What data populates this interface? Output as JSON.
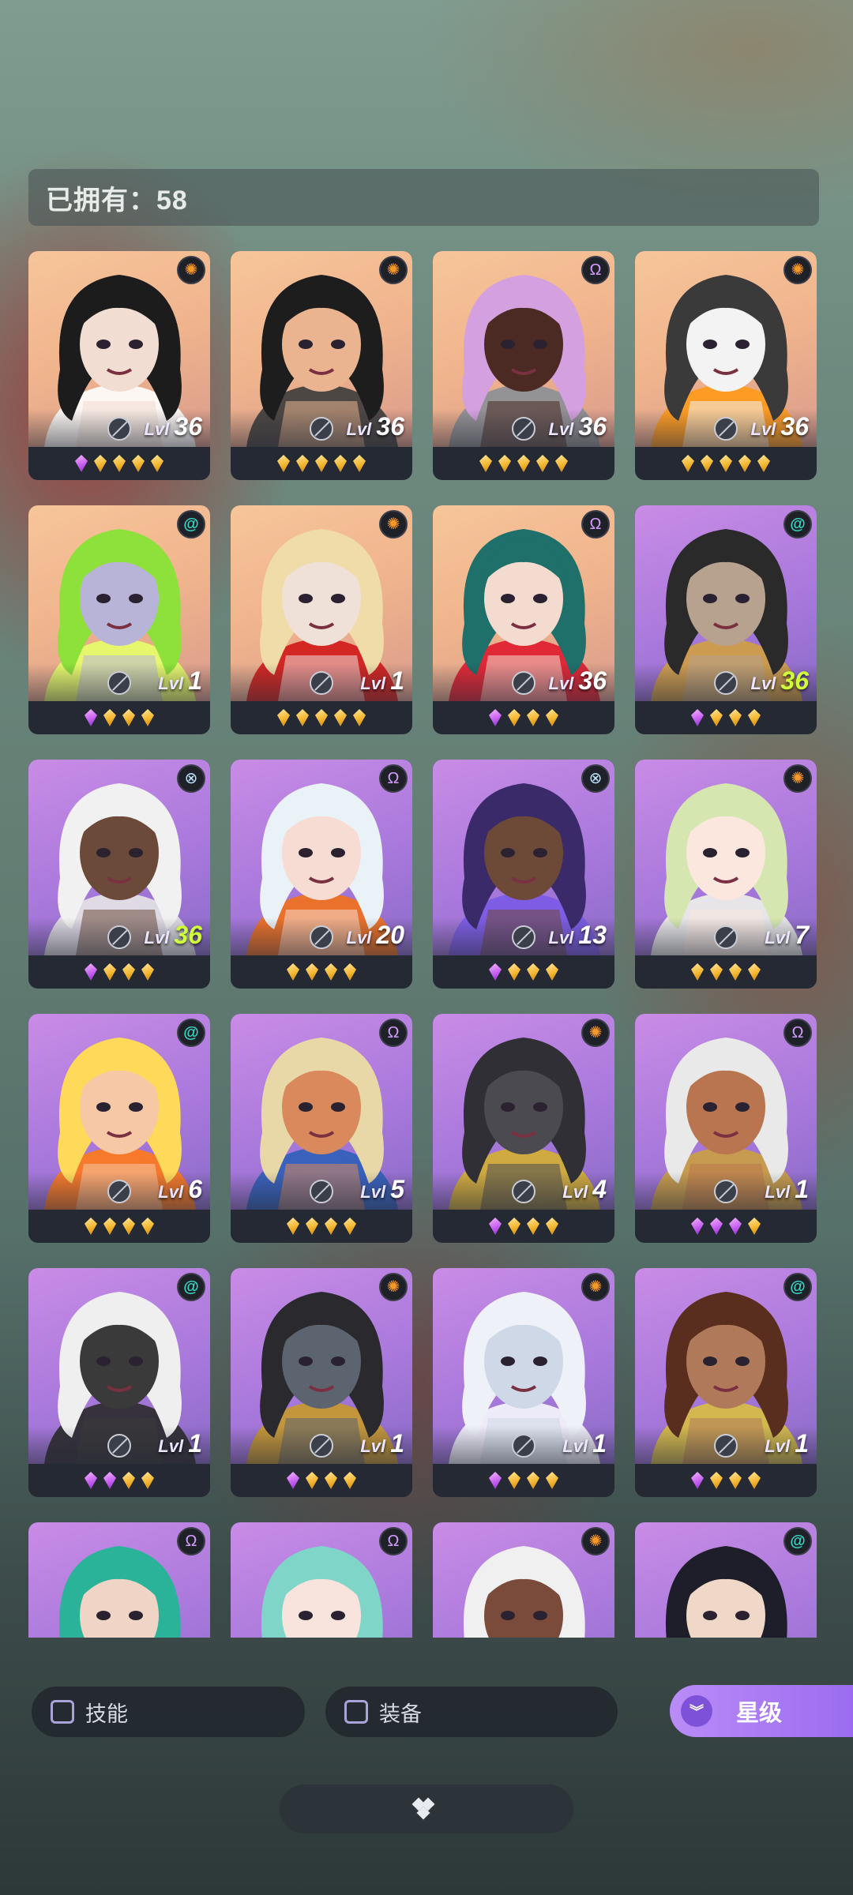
{
  "owned": {
    "label": "已拥有：58"
  },
  "heroes": [
    {
      "element": "sun",
      "bg": "peach",
      "level": "36",
      "stars": [
        "purple",
        "gold",
        "gold",
        "gold",
        "gold"
      ],
      "hair": "#1c1c1c",
      "skin": "#f1ddd2",
      "accent": "#ffffff"
    },
    {
      "element": "sun",
      "bg": "peach",
      "level": "36",
      "stars": [
        "gold",
        "gold",
        "gold",
        "gold",
        "gold"
      ],
      "hair": "#1d1d1d",
      "skin": "#e9b48f",
      "accent": "#3c3c3c"
    },
    {
      "element": "omega",
      "bg": "peach",
      "level": "36",
      "stars": [
        "gold",
        "gold",
        "gold",
        "gold",
        "gold"
      ],
      "hair": "#d5a0e0",
      "skin": "#4a2a23",
      "accent": "#8a8f96"
    },
    {
      "element": "sun",
      "bg": "peach",
      "level": "36",
      "stars": [
        "gold",
        "gold",
        "gold",
        "gold",
        "gold"
      ],
      "hair": "#3a3a3a",
      "skin": "#f3f3f3",
      "accent": "#ff9a1a"
    },
    {
      "element": "spiral",
      "bg": "peach",
      "level": "1",
      "stars": [
        "purple",
        "gold",
        "gold",
        "gold"
      ],
      "hair": "#8ee03a",
      "skin": "#b8b4d8",
      "accent": "#e6ff6a"
    },
    {
      "element": "sun",
      "bg": "peach",
      "level": "1",
      "stars": [
        "gold",
        "gold",
        "gold",
        "gold",
        "gold"
      ],
      "hair": "#f0dca8",
      "skin": "#efe0d8",
      "accent": "#d01818"
    },
    {
      "element": "omega",
      "bg": "peach",
      "level": "36",
      "stars": [
        "purple",
        "gold",
        "gold",
        "gold"
      ],
      "hair": "#1f6f6a",
      "skin": "#f3dccf",
      "accent": "#e0192d"
    },
    {
      "element": "spiral",
      "bg": "purple",
      "level": "36",
      "highlight": true,
      "stars": [
        "purple",
        "gold",
        "gold",
        "gold"
      ],
      "hair": "#2a2a2a",
      "skin": "#b7a18f",
      "accent": "#d0a040"
    },
    {
      "element": "cross",
      "bg": "purple",
      "level": "36",
      "highlight": true,
      "stars": [
        "purple",
        "gold",
        "gold",
        "gold"
      ],
      "hair": "#f1f1f1",
      "skin": "#6b4a3a",
      "accent": "#e6e6e6"
    },
    {
      "element": "omega",
      "bg": "purple",
      "level": "20",
      "stars": [
        "gold",
        "gold",
        "gold",
        "gold"
      ],
      "hair": "#e9f2f6",
      "skin": "#f6dcd2",
      "accent": "#f2711a"
    },
    {
      "element": "cross",
      "bg": "purple",
      "level": "13",
      "stars": [
        "purple",
        "gold",
        "gold",
        "gold"
      ],
      "hair": "#3a2a6a",
      "skin": "#6d4938",
      "accent": "#7a5be6"
    },
    {
      "element": "sun",
      "bg": "purple",
      "level": "7",
      "stars": [
        "gold",
        "gold",
        "gold",
        "gold"
      ],
      "hair": "#d6e6b0",
      "skin": "#fbe7dd",
      "accent": "#eef2ea"
    },
    {
      "element": "spiral",
      "bg": "purple",
      "level": "6",
      "stars": [
        "gold",
        "gold",
        "gold",
        "gold"
      ],
      "hair": "#ffd95a",
      "skin": "#f6c8a6",
      "accent": "#ff7a1a"
    },
    {
      "element": "omega",
      "bg": "purple",
      "level": "5",
      "stars": [
        "gold",
        "gold",
        "gold",
        "gold"
      ],
      "hair": "#e8d8a8",
      "skin": "#d9895b",
      "accent": "#2f5fb8"
    },
    {
      "element": "sun",
      "bg": "purple",
      "level": "4",
      "stars": [
        "purple",
        "gold",
        "gold",
        "gold"
      ],
      "hair": "#2f2f35",
      "skin": "#4a4a50",
      "accent": "#d4b030"
    },
    {
      "element": "omega",
      "bg": "purple",
      "level": "1",
      "stars": [
        "purple",
        "purple",
        "purple",
        "gold"
      ],
      "hair": "#e9e9e9",
      "skin": "#b9754f",
      "accent": "#caa040"
    },
    {
      "element": "spiral",
      "bg": "purple",
      "level": "1",
      "stars": [
        "purple",
        "purple",
        "gold",
        "gold"
      ],
      "hair": "#efefef",
      "skin": "#3a3a3a",
      "accent": "#2a2a2a"
    },
    {
      "element": "sun",
      "bg": "purple",
      "level": "1",
      "stars": [
        "purple",
        "gold",
        "gold",
        "gold"
      ],
      "hair": "#2a2a2e",
      "skin": "#5c6470",
      "accent": "#c89a2a"
    },
    {
      "element": "sun",
      "bg": "purple",
      "level": "1",
      "stars": [
        "purple",
        "gold",
        "gold",
        "gold"
      ],
      "hair": "#eef2f8",
      "skin": "#cfd8e6",
      "accent": "#f6f8fc"
    },
    {
      "element": "spiral",
      "bg": "purple",
      "level": "1",
      "stars": [
        "purple",
        "gold",
        "gold",
        "gold"
      ],
      "hair": "#5a2e1e",
      "skin": "#b07a5a",
      "accent": "#d8c040"
    },
    {
      "element": "omega",
      "bg": "purple",
      "hair": "#2bb39a",
      "skin": "#f0d4c6",
      "accent": "#3ad0c0"
    },
    {
      "element": "omega",
      "bg": "purple",
      "hair": "#7fd6c8",
      "skin": "#f8e4dc",
      "accent": "#e8c870"
    },
    {
      "element": "sun",
      "bg": "purple",
      "hair": "#f0f0f0",
      "skin": "#7a4a3a",
      "accent": "#ffffff"
    },
    {
      "element": "spiral",
      "bg": "purple",
      "hair": "#1e1e2a",
      "skin": "#f0d8c8",
      "accent": "#2a2a3a"
    }
  ],
  "level_prefix": "Lvl",
  "filters": {
    "skill_label": "技能",
    "equip_label": "装备"
  },
  "star_button": {
    "label": "星级"
  },
  "element_icons": {
    "sun": "sun-element-icon",
    "spiral": "spiral-element-icon",
    "omega": "omega-element-icon",
    "cross": "cross-element-icon"
  }
}
